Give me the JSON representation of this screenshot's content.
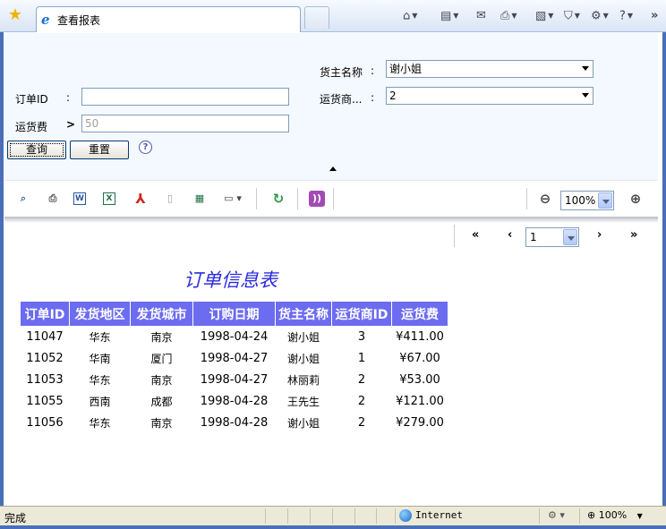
{
  "browser": {
    "tab_title": "查看报表",
    "more_label": "»"
  },
  "query": {
    "order_id_label": "订单ID",
    "order_id_value": "",
    "freight_label": "运货费",
    "freight_operator": ">",
    "freight_value": "50",
    "owner_label": "货主名称",
    "owner_value": "谢小姐",
    "shipper_label": "运货商...",
    "shipper_value": "2",
    "colon": ":",
    "query_button": "查询",
    "reset_button": "重置"
  },
  "toolbar": {
    "zoom_value": "100%"
  },
  "pager": {
    "first": "«",
    "prev": "‹",
    "page_value": "1",
    "next": "›",
    "last": "»"
  },
  "report": {
    "title": "订单信息表",
    "headers": [
      "订单ID",
      "发货地区",
      "发货城市",
      "订购日期",
      "货主名称",
      "运货商ID",
      "运货费"
    ],
    "rows": [
      [
        "11047",
        "华东",
        "南京",
        "1998-04-24",
        "谢小姐",
        "3",
        "¥411.00"
      ],
      [
        "11052",
        "华南",
        "厦门",
        "1998-04-27",
        "谢小姐",
        "1",
        "¥67.00"
      ],
      [
        "11053",
        "华东",
        "南京",
        "1998-04-27",
        "林丽莉",
        "2",
        "¥53.00"
      ],
      [
        "11055",
        "西南",
        "成都",
        "1998-04-28",
        "王先生",
        "2",
        "¥121.00"
      ],
      [
        "11056",
        "华东",
        "南京",
        "1998-04-28",
        "谢小姐",
        "2",
        "¥279.00"
      ]
    ]
  },
  "status": {
    "text": "完成",
    "zone": "Internet",
    "zoom": "100%"
  },
  "colors": {
    "header_bg": "#6c6cf0",
    "title_color": "#2b2bdb",
    "query_bg": "#f4f8ff"
  }
}
